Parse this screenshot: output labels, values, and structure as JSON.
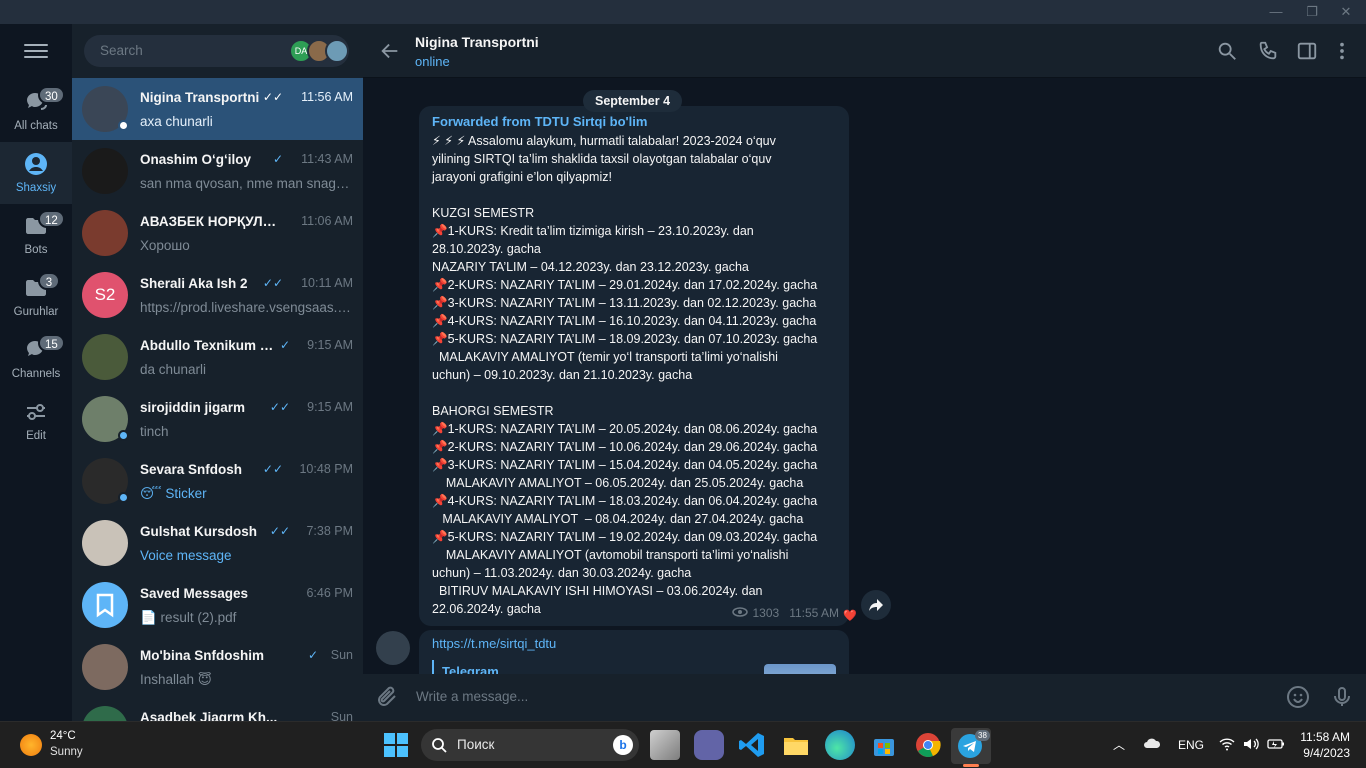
{
  "window": {
    "minimize": "—",
    "restore": "❐",
    "close": "✕"
  },
  "folders": [
    {
      "label": "All chats",
      "badge": "30",
      "icon": "chat-bubbles-icon"
    },
    {
      "label": "Shaxsiy",
      "badge": "",
      "icon": "person-icon"
    },
    {
      "label": "Bots",
      "badge": "12",
      "icon": "folder-icon"
    },
    {
      "label": "Guruhlar",
      "badge": "3",
      "icon": "folder-icon"
    },
    {
      "label": "Channels",
      "badge": "15",
      "icon": "chat-bubbles-icon"
    },
    {
      "label": "Edit",
      "badge": "",
      "icon": "sliders-icon"
    }
  ],
  "search": {
    "placeholder": "Search",
    "avatars": [
      "DA",
      "",
      ""
    ]
  },
  "chats": [
    {
      "name": "Nigina Transportni",
      "time": "11:56 AM",
      "ticks": "✓✓",
      "preview": "axa chunarli",
      "online": true,
      "avatar_color": "#3a4656",
      "active": true
    },
    {
      "name": "Onashim O‘g‘iloy",
      "time": "11:43 AM",
      "ticks": "✓",
      "preview": "san nma qvosan, nme man snaga ...",
      "online": false,
      "avatar_color": "#1a1a1a"
    },
    {
      "name": "АВАЗБЕК НОРҚУЛОВ",
      "time": "11:06 AM",
      "ticks": "",
      "preview": "Хорошо",
      "online": false,
      "avatar_color": "#7a3b2e"
    },
    {
      "name": "Sherali Aka Ish 2",
      "time": "10:11 AM",
      "ticks": "✓✓",
      "preview": "https://prod.liveshare.vsengsaas.v...",
      "online": false,
      "avatar_initials": "S2",
      "avatar_color": "#e0526e"
    },
    {
      "name": "Abdullo Texnikum C...",
      "time": "9:15 AM",
      "ticks": "✓",
      "preview": "da chunarli",
      "online": false,
      "avatar_color": "#4a5a3a"
    },
    {
      "name": "sirojiddin jigarm",
      "time": "9:15 AM",
      "ticks": "✓✓",
      "preview": "tinch",
      "online": true,
      "avatar_color": "#6e7f6a"
    },
    {
      "name": "Sevara Snfdosh",
      "time": "10:48 PM",
      "ticks": "✓✓",
      "preview": "😴 Sticker",
      "preview_accent": true,
      "online": true,
      "avatar_color": "#2a2a2a"
    },
    {
      "name": "Gulshat Kursdosh",
      "time": "7:38 PM",
      "ticks": "✓✓",
      "preview": "Voice message",
      "preview_accent": true,
      "online": false,
      "avatar_color": "#c9c2b8"
    },
    {
      "name": "Saved Messages",
      "time": "6:46 PM",
      "ticks": "",
      "preview": "📄 result (2).pdf",
      "online": false,
      "avatar_color": "#5eb5f7"
    },
    {
      "name": "Mo'bina Snfdoshim",
      "time": "Sun",
      "ticks": "✓",
      "preview": "Inshallah 😇",
      "online": false,
      "avatar_color": "#7d6a60"
    },
    {
      "name": "Asadbek Jiagrm Kh...",
      "time": "Sun",
      "ticks": "",
      "preview": "",
      "online": false,
      "avatar_color": "#2f6b4a"
    }
  ],
  "header": {
    "title": "Nigina Transportni",
    "status": "online"
  },
  "date_pill": "September 4",
  "message": {
    "forwarded_from": "Forwarded from TDTU Sirtqi bo'lim",
    "lines": [
      "⚡ ⚡ ⚡ Assalomu alaykum, hurmatli talabalar! 2023-2024 o‘quv",
      "yilining SIRTQI ta’lim shaklida taxsil olayotgan talabalar o‘quv",
      "jarayoni grafigini e’lon qilyapmiz!",
      "",
      "KUZGI SEMESTR",
      "📌1-KURS: Kredit ta’lim tizimiga kirish – 23.10.2023y. dan",
      "28.10.2023y. gacha",
      "NAZARIY TA’LIM – 04.12.2023y. dan 23.12.2023y. gacha",
      "📌2-KURS: NAZARIY TA’LIM – 29.01.2024y. dan 17.02.2024y. gacha",
      "📌3-KURS: NAZARIY TA’LIM – 13.11.2023y. dan 02.12.2023y. gacha",
      "📌4-KURS: NAZARIY TA’LIM – 16.10.2023y. dan 04.11.2023y. gacha",
      "📌5-KURS: NAZARIY TA’LIM – 18.09.2023y. dan 07.10.2023y. gacha",
      "  MALAKAVIY AMALIYOT (temir yo‘l transporti ta’limi yo‘nalishi",
      "uchun) – 09.10.2023y. dan 21.10.2023y. gacha",
      "",
      "BAHORGI SEMESTR",
      "📌1-KURS: NAZARIY TA’LIM – 20.05.2024y. dan 08.06.2024y. gacha",
      "📌2-KURS: NAZARIY TA’LIM – 10.06.2024y. dan 29.06.2024y. gacha",
      "📌3-KURS: NAZARIY TA’LIM – 15.04.2024y. dan 04.05.2024y. gacha",
      "    MALAKAVIY AMALIYOT – 06.05.2024y. dan 25.05.2024y. gacha",
      "📌4-KURS: NAZARIY TA’LIM – 18.03.2024y. dan 06.04.2024y. gacha",
      "   MALAKAVIY AMALIYOT  – 08.04.2024y. dan 27.04.2024y. gacha",
      "📌5-KURS: NAZARIY TA’LIM – 19.02.2024y. dan 09.03.2024y. gacha",
      "    MALAKAVIY AMALIYOT (avtomobil transporti ta’limi yo‘nalishi",
      "uchun) – 11.03.2024y. dan 30.03.2024y. gacha",
      "  BITIRUV MALAKAVIY ISHI HIMOYASI – 03.06.2024y. dan",
      "22.06.2024y. gacha"
    ],
    "views": "1303",
    "time": "11:55 AM",
    "reaction": "❤️"
  },
  "message2": {
    "link": "https://t.me/sirtqi_tdtu",
    "preview_title": "Telegram"
  },
  "composer": {
    "placeholder": "Write a message..."
  },
  "taskbar": {
    "weather_temp": "24°C",
    "weather_desc": "Sunny",
    "search_placeholder": "Поиск",
    "telegram_badge": "38",
    "language": "ENG",
    "time": "11:58 AM",
    "date": "9/4/2023"
  }
}
